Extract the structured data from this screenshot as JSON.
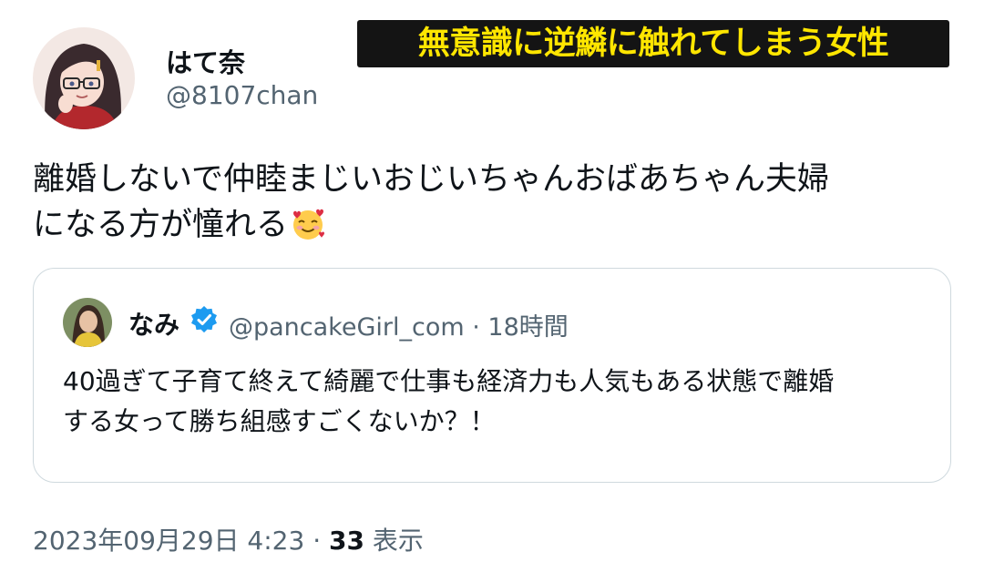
{
  "author": {
    "display_name": "はて奈",
    "handle": "@8107chan"
  },
  "caption": "無意識に逆鱗に触れてしまう女性",
  "tweet": {
    "lines": [
      "離婚しないで仲睦まじいおじいちゃんおばあちゃん夫婦",
      "になる方が憧れる"
    ],
    "emoji": "smiling-face-with-hearts"
  },
  "quoted_tweet": {
    "display_name": "なみ",
    "handle_time": "@pancakeGirl_com · 18時間",
    "verified": true,
    "lines": [
      "40過ぎて子育て終えて綺麗で仕事も経済力も人気もある状態で離婚",
      "する女って勝ち組感すごくないか？！"
    ]
  },
  "meta": {
    "timestamp": "2023年09月29日 4:23 · ",
    "view_count": "33",
    "view_label": " 表示"
  },
  "colors": {
    "text": "#0f1419",
    "secondary": "#536471",
    "border": "#cfd9de",
    "verified": "#1d9bf0",
    "caption_bg": "#141414",
    "caption_fg": "#ffe600"
  }
}
